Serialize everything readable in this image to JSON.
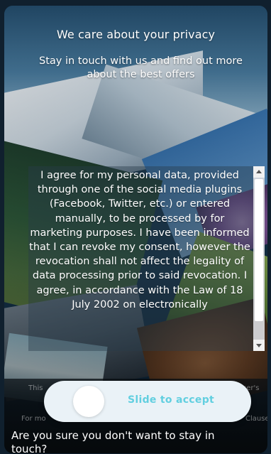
{
  "header": {
    "title": "We care about your privacy",
    "subtitle": "Stay in touch with us and find out more about the best offers"
  },
  "consent": {
    "text": "I agree for my personal data, provided through one of the social media plugins (Facebook, Twitter, etc.) or entered manually, to be processed by for marketing purposes. I have been informed that I can revoke my consent, however the revocation shall not affect the legality of data processing prior to said revocation. I agree, in accordance with the Law of 18 July 2002 on electronically"
  },
  "footer_notes": {
    "line1_left": "This",
    "line1_right": "ser's",
    "line2_left": "For mo",
    "line2_right": "Clause"
  },
  "slider": {
    "label": "Slide to accept",
    "accent_color": "#62cfe0"
  },
  "question": "Are you sure you don't want to stay in touch?"
}
